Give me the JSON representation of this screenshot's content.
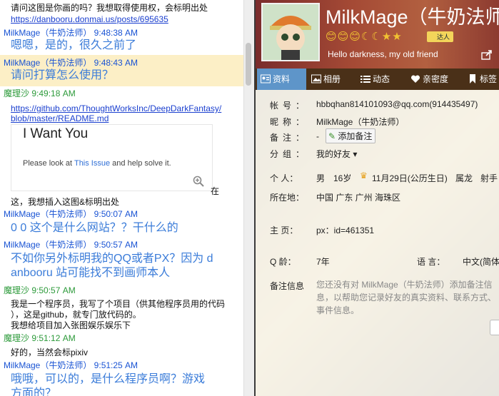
{
  "chat": {
    "messages": [
      {
        "text": "请问这图是你画的吗？我想取得使用权，会标明出处"
      },
      {
        "link": "https://danbooru.donmai.us/posts/695635"
      },
      {
        "sender": "MilkMage（牛奶法师） 9:48:38 AM"
      },
      {
        "big": "嗯嗯，是的，很久之前了"
      },
      {
        "sender": "MilkMage（牛奶法师） 9:48:43 AM"
      },
      {
        "big": "请问打算怎么使用？"
      },
      {
        "sender": "魔理沙 9:49:18 AM"
      },
      {
        "link1": "https://github.com/ThoughtWorksInc/DeepDarkFantasy/",
        "link2": "blob/master/README.md"
      },
      {
        "after_img": "在",
        "text": "这，我想插入这图&标明出处"
      },
      {
        "sender": "MilkMage（牛奶法师） 9:50:07 AM"
      },
      {
        "big": "0 0 这个是什么网站？？干什么的"
      },
      {
        "sender": "MilkMage（牛奶法师） 9:50:57 AM"
      },
      {
        "big1": "不如你另外标明我的QQ或者PX？因为 d",
        "big2": "anbooru 站可能找不到画师本人"
      },
      {
        "sender": "魔理沙 9:50:57 AM"
      },
      {
        "l1": "我是一个程序员，我写了个项目（供其他程序员用的代码",
        "l2": "），这是github，就专门放代码的。",
        "l3": "我想给项目加入张图娱乐娱乐下"
      },
      {
        "sender": "魔理沙 9:51:12 AM"
      },
      {
        "text": "好的，当然会标pixiv"
      },
      {
        "sender": "MilkMage（牛奶法师） 9:51:25 AM"
      },
      {
        "big1": "哦哦，可以的，是什么程序员啊？游戏",
        "big2": "方面的？"
      }
    ],
    "card": {
      "title": "I Want You",
      "body_prefix": "Please look at ",
      "body_link": "This Issue",
      "body_suffix": " and help solve it."
    }
  },
  "profile": {
    "nickname": "MilkMage（牛奶法师",
    "badges": "😊😊😊☾☾★★",
    "talent": "达人",
    "signature": "Hello darkness, my old friend",
    "tabs": [
      "资料",
      "相册",
      "动态",
      "亲密度",
      "标签"
    ],
    "fields": {
      "account_label": "帐号：",
      "account": "hbbqhan814101093@qq.com(914435497)",
      "nick_label": "昵称：",
      "nick": "MilkMage（牛奶法师）",
      "remark_label": "备注：",
      "remark": "-",
      "add_remark": "添加备注",
      "group_label": "分组：",
      "group": "我的好友 ▾",
      "personal_label": "个 人：",
      "gender": "男",
      "age": "16岁",
      "birthday": "11月29日(公历生日)",
      "zodiac": "属龙",
      "sign": "射手",
      "location_label": "所在地：",
      "location": "中国 广东 广州 海珠区",
      "homepage_label": "主 页：",
      "homepage": "px：id=461351",
      "qage_label": "Q 龄：",
      "qage": "7年",
      "lang_label": "语 言：",
      "lang": "中文(简体",
      "remark_info_label": "备注信息",
      "remark_info": "您还没有对 MilkMage（牛奶法师）添加备注信息，以帮助您记录好友的真实资料、联系方式、事件信息。"
    }
  },
  "colors": {
    "sender_milkmage": "#1a54d4",
    "sender_marisa": "#2c9a3a",
    "big_text": "#3b7cd9",
    "highlight": "#fcefc6",
    "tab_active": "#5e95c9"
  }
}
